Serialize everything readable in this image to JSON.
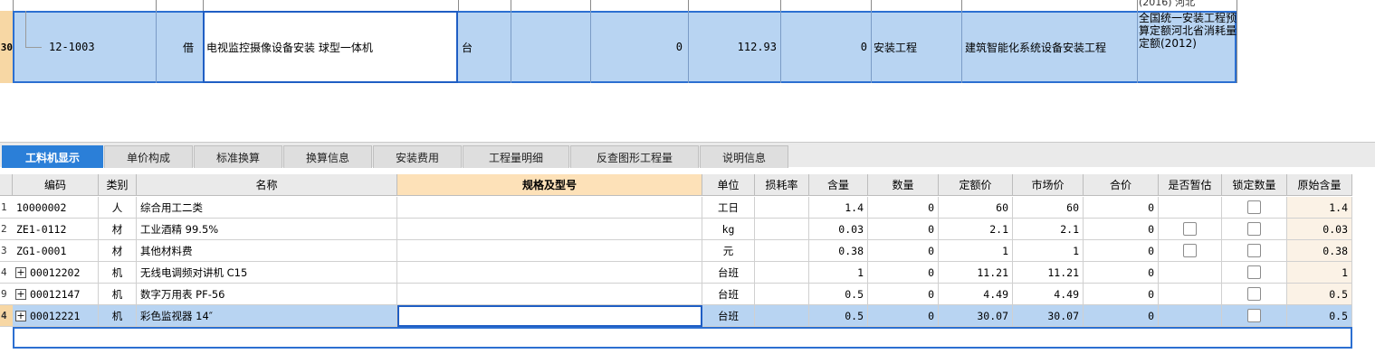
{
  "top_row": {
    "row_number": "30",
    "code": "12-1003",
    "category": "借",
    "name": "电视监控摄像设备安装 球型一体机",
    "unit": "台",
    "quantity": "0",
    "unit_price": "112.93",
    "total": "0",
    "specialty": "安装工程",
    "chapter": "建筑智能化系统设备安装工程",
    "above_text": "(2016) 河北",
    "library": "全国统一安装工程预算定额河北省消耗量定额(2012)"
  },
  "tabs": [
    {
      "label": "工料机显示",
      "active": true
    },
    {
      "label": "单价构成"
    },
    {
      "label": "标准换算"
    },
    {
      "label": "换算信息"
    },
    {
      "label": "安装费用"
    },
    {
      "label": "工程量明细"
    },
    {
      "label": "反查图形工程量"
    },
    {
      "label": "说明信息"
    }
  ],
  "table": {
    "headers": [
      "编码",
      "类别",
      "名称",
      "规格及型号",
      "单位",
      "损耗率",
      "含量",
      "数量",
      "定额价",
      "市场价",
      "合价",
      "是否暂估",
      "锁定数量",
      "原始含量"
    ],
    "rows": [
      {
        "no": "1",
        "code": "10000002",
        "expand": false,
        "type": "人",
        "name": "综合用工二类",
        "spec": "",
        "unit": "工日",
        "loss": "",
        "content": "1.4",
        "qty": "0",
        "quota_price": "60",
        "market_price": "60",
        "total": "0",
        "estimate_checkbox": false,
        "original": "1.4"
      },
      {
        "no": "2",
        "code": "ZE1-0112",
        "expand": false,
        "type": "材",
        "name": "工业酒精 99.5%",
        "spec": "",
        "unit": "kg",
        "loss": "",
        "content": "0.03",
        "qty": "0",
        "quota_price": "2.1",
        "market_price": "2.1",
        "total": "0",
        "estimate_checkbox": true,
        "original": "0.03"
      },
      {
        "no": "3",
        "code": "ZG1-0001",
        "expand": false,
        "type": "材",
        "name": "其他材料费",
        "spec": "",
        "unit": "元",
        "loss": "",
        "content": "0.38",
        "qty": "0",
        "quota_price": "1",
        "market_price": "1",
        "total": "0",
        "estimate_checkbox": true,
        "original": "0.38"
      },
      {
        "no": "4",
        "code": "00012202",
        "expand": true,
        "type": "机",
        "name": "无线电调频对讲机 C15",
        "spec": "",
        "unit": "台班",
        "loss": "",
        "content": "1",
        "qty": "0",
        "quota_price": "11.21",
        "market_price": "11.21",
        "total": "0",
        "estimate_checkbox": false,
        "original": "1"
      },
      {
        "no": "9",
        "code": "00012147",
        "expand": true,
        "type": "机",
        "name": "数字万用表 PF-56",
        "spec": "",
        "unit": "台班",
        "loss": "",
        "content": "0.5",
        "qty": "0",
        "quota_price": "4.49",
        "market_price": "4.49",
        "total": "0",
        "estimate_checkbox": false,
        "original": "0.5"
      },
      {
        "no": "4",
        "code": "00012221",
        "expand": true,
        "type": "机",
        "name": "彩色监视器 14″",
        "spec": "",
        "unit": "台班",
        "loss": "",
        "content": "0.5",
        "qty": "0",
        "quota_price": "30.07",
        "market_price": "30.07",
        "total": "0",
        "estimate_checkbox": false,
        "original": "0.5",
        "selected": true
      }
    ]
  }
}
